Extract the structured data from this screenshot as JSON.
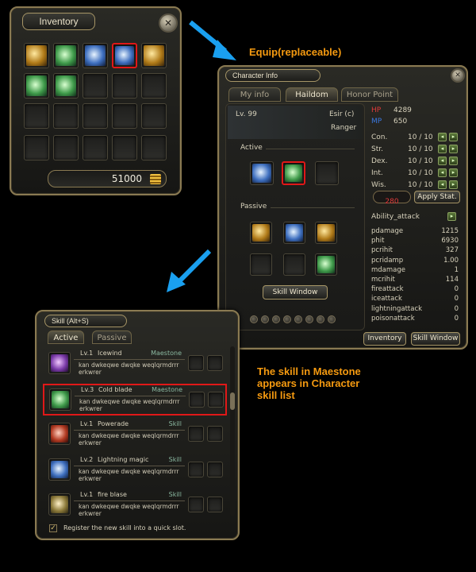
{
  "inventory": {
    "title": "Inventory",
    "close": "✕",
    "gold": "51000",
    "slots": [
      {
        "icon": "gold-sword-skill-icon",
        "color": "gold"
      },
      {
        "icon": "green-leaf-skill-icon",
        "color": "green"
      },
      {
        "icon": "blue-sword-skill-icon",
        "color": "blue"
      },
      {
        "icon": "blue-blade-skill-icon",
        "color": "blue",
        "selected": true
      },
      {
        "icon": "gold-orb-skill-icon",
        "color": "gold"
      },
      {
        "icon": "green-crystal-skill-icon",
        "color": "green"
      },
      {
        "icon": "green-flower-skill-icon",
        "color": "green"
      }
    ]
  },
  "captions": {
    "equip": "Equip(replaceable)",
    "maestone_line1": "The skill in Maestone",
    "maestone_line2": "appears in Character",
    "maestone_line3": "skill list"
  },
  "character": {
    "title": "Character Info",
    "tabs": [
      "My info",
      "Haildom",
      "Honor Point"
    ],
    "level": "Lv. 99",
    "name": "Esir (c)",
    "class": "Ranger",
    "active_label": "Active",
    "passive_label": "Passive",
    "skill_window_btn": "Skill Window",
    "hp_label": "HP",
    "hp": "4289",
    "mp_label": "MP",
    "mp": "650",
    "stats": [
      {
        "name": "Con.",
        "value": "10 / 10"
      },
      {
        "name": "Str.",
        "value": "10 / 10"
      },
      {
        "name": "Dex.",
        "value": "10 / 10"
      },
      {
        "name": "Int.",
        "value": "10 / 10"
      },
      {
        "name": "Wis.",
        "value": "10 / 10"
      }
    ],
    "points": "280",
    "apply_btn": "Apply Stat.",
    "ability": "Ability_attack",
    "attrs": [
      {
        "name": "pdamage",
        "value": "1215"
      },
      {
        "name": "phit",
        "value": "6930"
      },
      {
        "name": "pcrihit",
        "value": "327"
      },
      {
        "name": "pcridamp",
        "value": "1.00"
      },
      {
        "name": "mdamage",
        "value": "1"
      },
      {
        "name": "mcrihit",
        "value": "114"
      },
      {
        "name": "fireattack",
        "value": "0"
      },
      {
        "name": "iceattack",
        "value": "0"
      },
      {
        "name": "lightningattack",
        "value": "0"
      },
      {
        "name": "poisonattack",
        "value": "0"
      }
    ],
    "inventory_btn": "Inventory",
    "skill_window_btn2": "Skill Window"
  },
  "skill": {
    "title": "Skill (Alt+S)",
    "tabs": [
      "Active",
      "Passive"
    ],
    "desc": "kan dwkeqwe dwqke weqlqrmdrrr erkwrer",
    "rows": [
      {
        "level": "Lv.1",
        "name": "Icewind",
        "type": "Maestone",
        "color": "purple"
      },
      {
        "level": "Lv.3",
        "name": "Cold blade",
        "type": "Maestone",
        "color": "green",
        "selected": true
      },
      {
        "level": "Lv.1",
        "name": "Powerade",
        "type": "Skill",
        "color": "red"
      },
      {
        "level": "Lv.2",
        "name": "Lightning magic",
        "type": "Skill",
        "color": "blue"
      },
      {
        "level": "Lv.1",
        "name": "fire blase",
        "type": "Skill",
        "color": "olive"
      }
    ],
    "register_text": "Register the new skill into a quick slot."
  }
}
